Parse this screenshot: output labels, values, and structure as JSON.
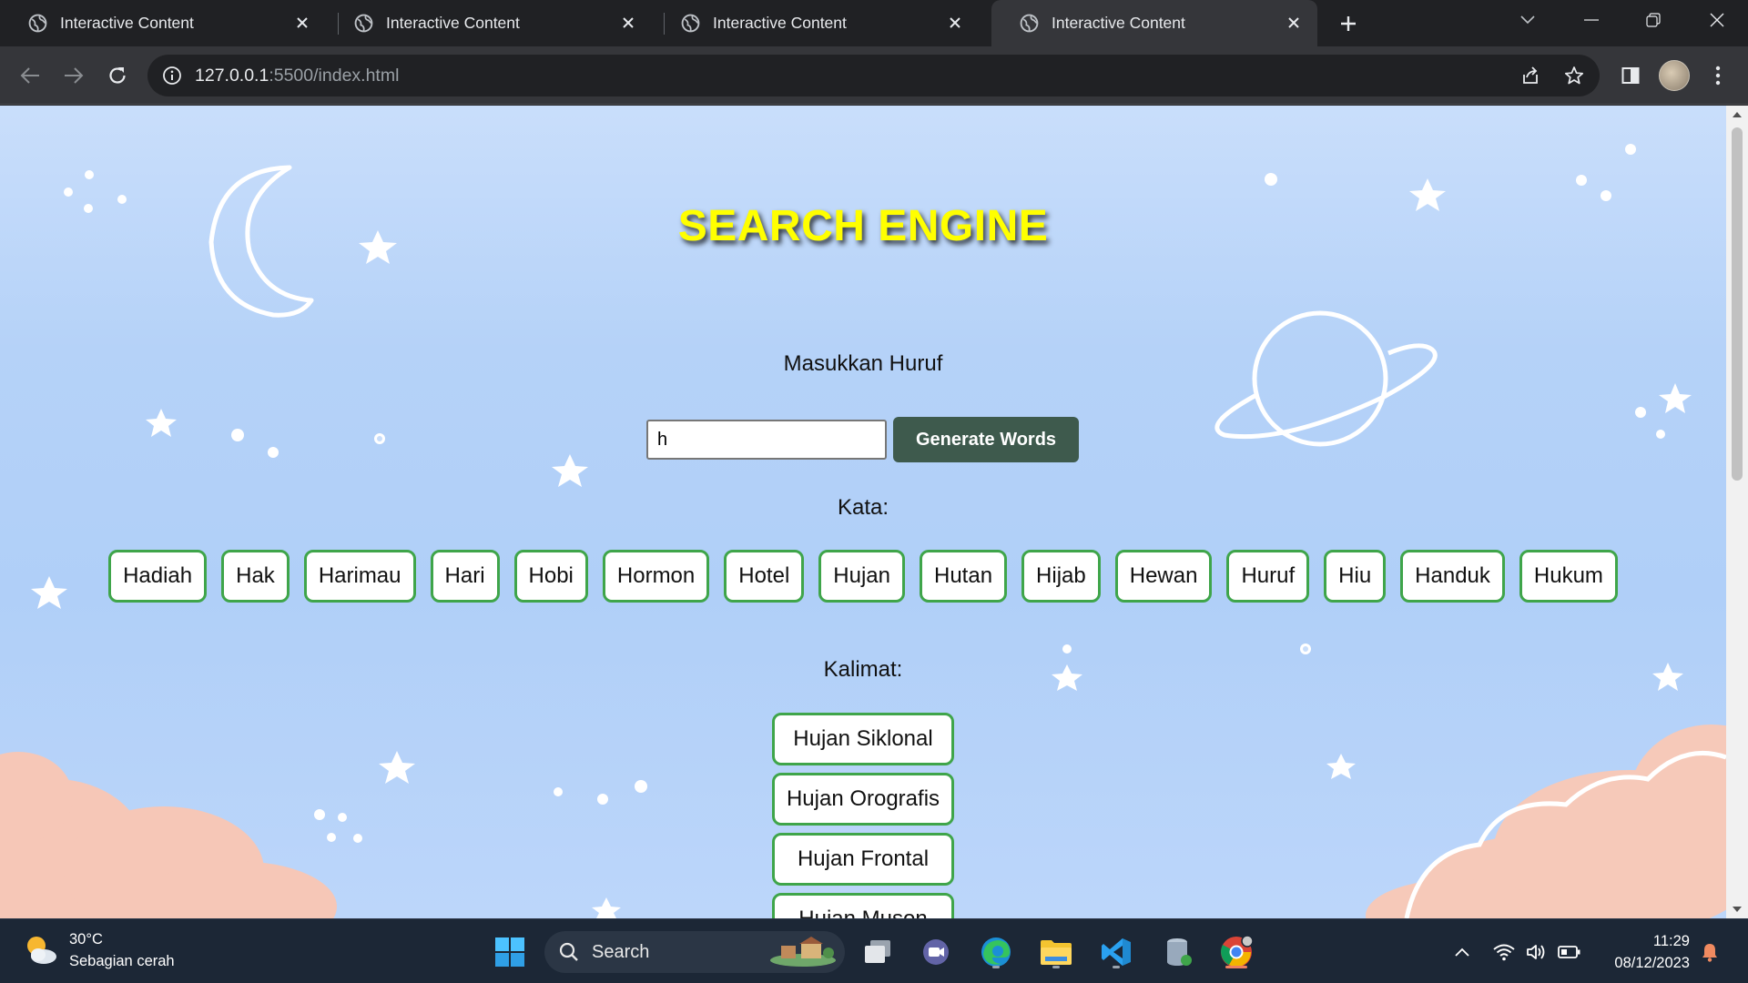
{
  "browser": {
    "tabs": [
      {
        "title": "Interactive Content",
        "active": false
      },
      {
        "title": "Interactive Content",
        "active": false
      },
      {
        "title": "Interactive Content",
        "active": false
      },
      {
        "title": "Interactive Content",
        "active": true
      }
    ],
    "url_host": "127.0.0.1",
    "url_rest": ":5500/index.html"
  },
  "page": {
    "title": "SEARCH ENGINE",
    "prompt_label": "Masukkan Huruf",
    "input_value": "h",
    "generate_button": "Generate Words",
    "words_label": "Kata:",
    "words": [
      "Hadiah",
      "Hak",
      "Harimau",
      "Hari",
      "Hobi",
      "Hormon",
      "Hotel",
      "Hujan",
      "Hutan",
      "Hijab",
      "Hewan",
      "Huruf",
      "Hiu",
      "Handuk",
      "Hukum"
    ],
    "sentences_label": "Kalimat:",
    "sentences": [
      "Hujan Siklonal",
      "Hujan Orografis",
      "Hujan Frontal",
      "Hujan Muson"
    ]
  },
  "taskbar": {
    "weather_temp": "30°C",
    "weather_desc": "Sebagian cerah",
    "search_placeholder": "Search",
    "time": "11:29",
    "date": "08/12/2023"
  },
  "colors": {
    "title": "#ffff00",
    "chip_border": "#3fa54a",
    "button": "#3e5a4d",
    "sky": "#b5d2f8"
  }
}
